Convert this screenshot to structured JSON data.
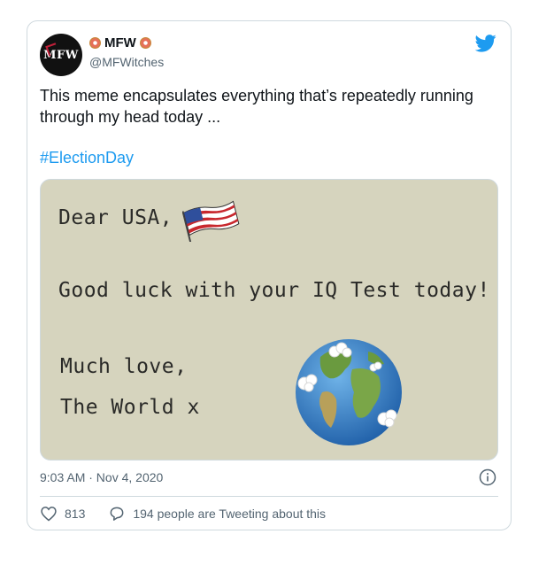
{
  "tweet": {
    "display_name": "MFW",
    "handle": "@MFWitches",
    "avatar_text": "MFW",
    "text": "This meme encapsulates everything that’s repeatedly running through my head today ...",
    "hashtag": "#ElectionDay",
    "timestamp": "9:03 AM · Nov 4, 2020",
    "likes": "813",
    "reply_text": "194 people are Tweeting about this"
  },
  "meme": {
    "line1": "Dear USA,",
    "line2": "Good luck with your IQ Test today!",
    "line3": "Much love,",
    "line4": "The World x"
  },
  "colors": {
    "link": "#1d9bf0",
    "meme_bg": "#d6d4be",
    "border": "#cfd9de",
    "muted": "#536471"
  },
  "icons": [
    "donut-emoji-icon",
    "twitter-bird-icon",
    "info-icon",
    "heart-icon",
    "speech-bubble-icon",
    "usa-flag-icon",
    "globe-icon"
  ]
}
